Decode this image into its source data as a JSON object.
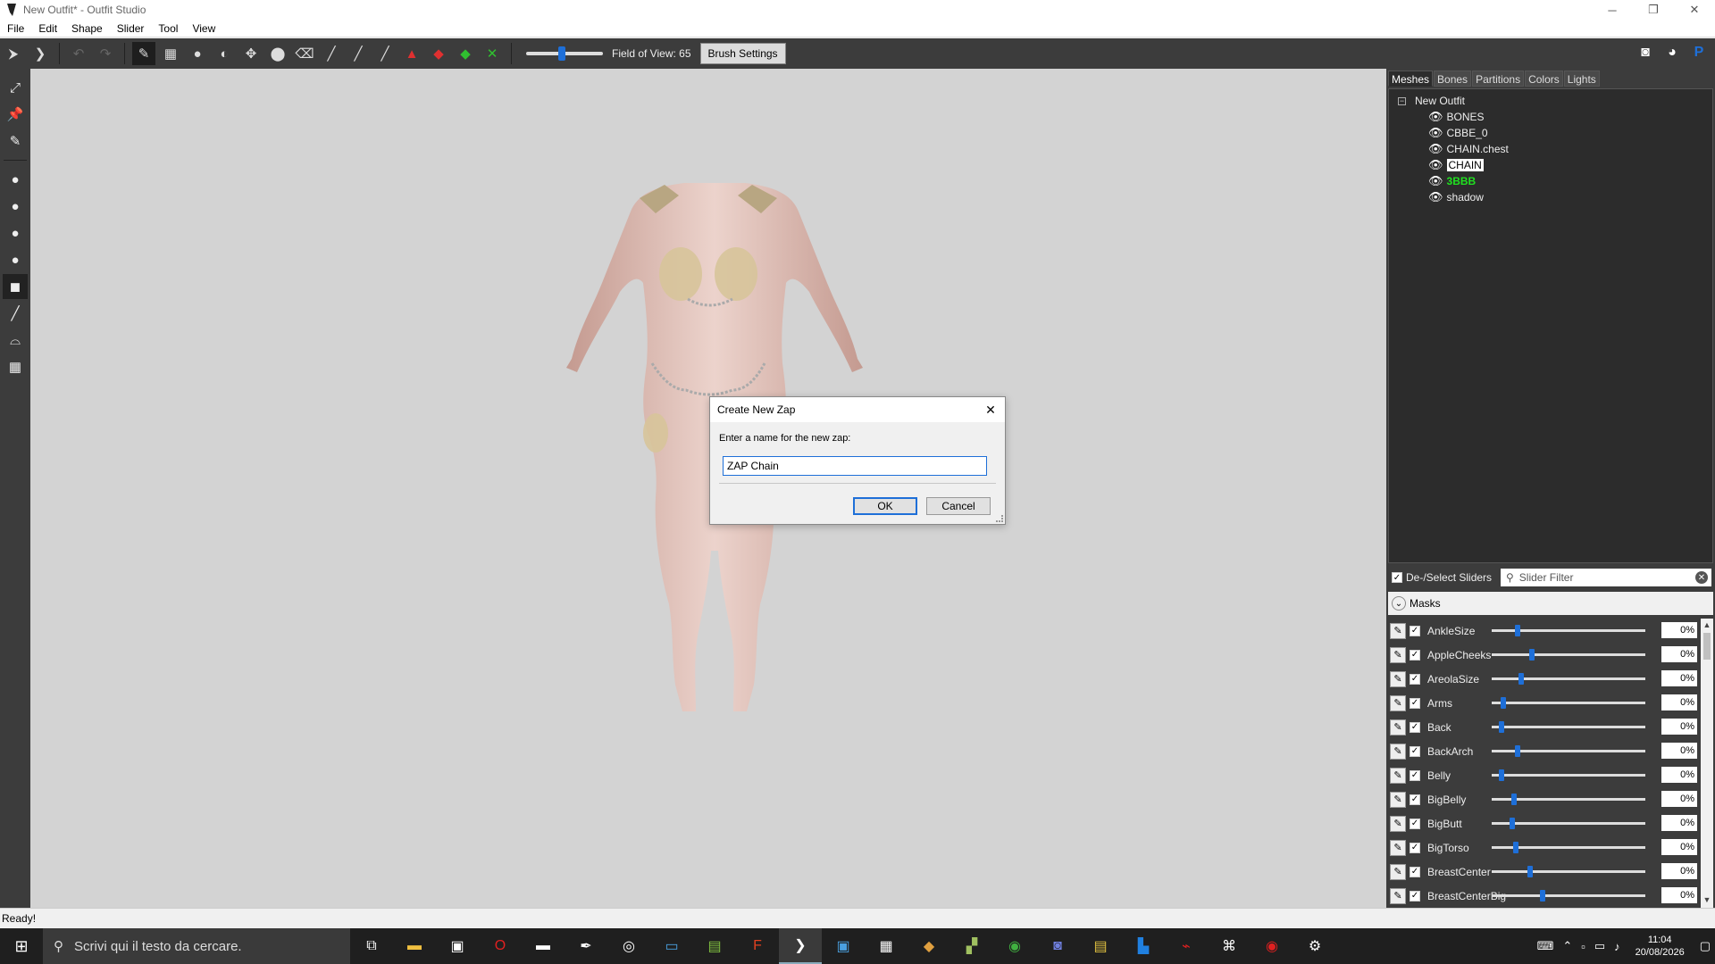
{
  "window": {
    "title": "New Outfit* - Outfit Studio",
    "controls": [
      "─",
      "❐",
      "✕"
    ]
  },
  "menu": [
    "File",
    "Edit",
    "Shape",
    "Slider",
    "Tool",
    "View"
  ],
  "toolbar": {
    "fov_label": "Field of View: 65",
    "fov_value": 65,
    "brush_settings": "Brush Settings"
  },
  "tabs": [
    "Meshes",
    "Bones",
    "Partitions",
    "Colors",
    "Lights"
  ],
  "tree": {
    "root": "New Outfit",
    "items": [
      {
        "label": "BONES"
      },
      {
        "label": "CBBE_0"
      },
      {
        "label": "CHAIN.chest"
      },
      {
        "label": "CHAIN"
      },
      {
        "label": "3BBB"
      },
      {
        "label": "shadow"
      }
    ]
  },
  "slider_panel": {
    "deselect_label": "De-/Select Sliders",
    "filter_placeholder": "Slider Filter",
    "masks_label": "Masks"
  },
  "sliders": [
    {
      "name": "AnkleSize",
      "pct": "0%"
    },
    {
      "name": "AppleCheeks",
      "pct": "0%"
    },
    {
      "name": "AreolaSize",
      "pct": "0%"
    },
    {
      "name": "Arms",
      "pct": "0%"
    },
    {
      "name": "Back",
      "pct": "0%"
    },
    {
      "name": "BackArch",
      "pct": "0%"
    },
    {
      "name": "Belly",
      "pct": "0%"
    },
    {
      "name": "BigBelly",
      "pct": "0%"
    },
    {
      "name": "BigButt",
      "pct": "0%"
    },
    {
      "name": "BigTorso",
      "pct": "0%"
    },
    {
      "name": "BreastCenter",
      "pct": "0%"
    },
    {
      "name": "BreastCenterBig",
      "pct": "0%"
    }
  ],
  "dialog": {
    "title": "Create New Zap",
    "prompt": "Enter a name for the new zap:",
    "input_value": "ZAP Chain",
    "ok": "OK",
    "cancel": "Cancel"
  },
  "status": "Ready!",
  "taskbar": {
    "search_placeholder": "Scrivi qui il testo da cercare.",
    "time": "11:04",
    "date": "20/08/2026"
  },
  "colors": {
    "accent": "#1e6fd8",
    "panel_dark": "#3c3c3c",
    "viewport": "#d3d3d3",
    "highlight_green": "#20e020"
  }
}
